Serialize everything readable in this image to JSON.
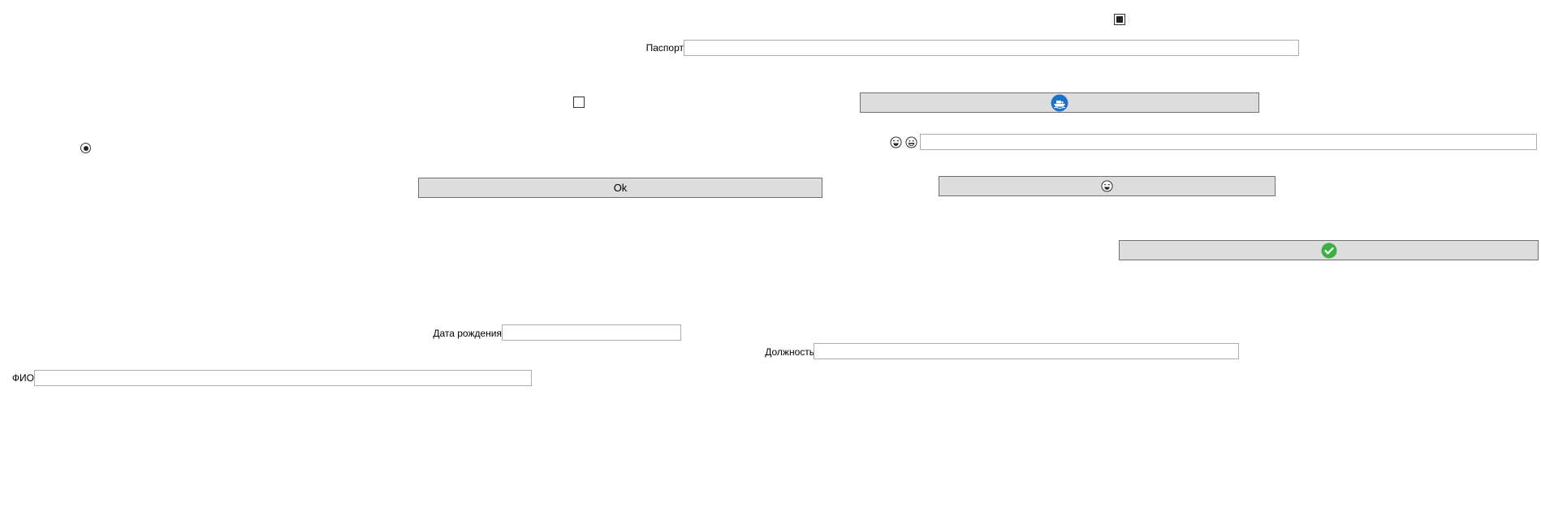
{
  "form": {
    "passport_label": "Паспорт",
    "passport_value": "",
    "birthdate_label": "Дата рождения",
    "birthdate_value": "",
    "position_label": "Должность",
    "position_value": "",
    "fio_label": "ФИО",
    "fio_value": "",
    "emoji_text_value": ""
  },
  "buttons": {
    "ok_label": "Ok",
    "ship_icon": "ship-icon",
    "emoji_icon": "laughing-face-icon",
    "check_icon": "green-check-icon"
  },
  "controls": {
    "top_checkbox_checked": true,
    "mid_checkbox_checked": false,
    "radio_checked": true
  },
  "colors": {
    "button_bg": "#dddddd",
    "button_border": "#707070",
    "field_border": "#abadb3",
    "ship_blue": "#1a73c8",
    "check_green": "#3cb043"
  }
}
